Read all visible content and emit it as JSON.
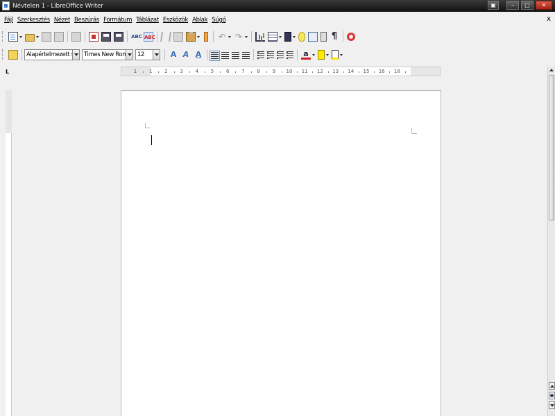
{
  "window": {
    "title": "Névtelen 1 - LibreOffice Writer"
  },
  "menu": [
    "Fájl",
    "Szerkesztés",
    "Nézet",
    "Beszúrás",
    "Formátum",
    "Táblázat",
    "Eszközök",
    "Ablak",
    "Súgó"
  ],
  "doc_close": "x",
  "format_toolbar": {
    "paragraph_style": "Alapértelmezett stílus",
    "font_name": "Times New Roman",
    "font_size": "12"
  },
  "ruler": {
    "corner": "L",
    "ticks": [
      "1",
      "1",
      "2",
      "3",
      "4",
      "5",
      "6",
      "7",
      "8",
      "9",
      "10",
      "11",
      "12",
      "13",
      "14",
      "15",
      "16",
      "18"
    ]
  },
  "icons": {
    "standard": [
      "new-document-icon",
      "open-icon",
      "save-icon",
      "edit-file-icon",
      "export-pdf-icon",
      "print-icon",
      "print-preview-icon",
      "spellcheck-icon",
      "autospellcheck-icon",
      "cut-icon",
      "copy-icon",
      "paste-icon",
      "clone-formatting-icon",
      "undo-icon",
      "redo-icon",
      "chart-icon",
      "table-icon",
      "draw-functions-icon",
      "find-replace-icon",
      "navigator-icon",
      "gallery-icon",
      "formatting-marks-icon",
      "help-icon"
    ],
    "format": [
      "styles-icon",
      "bold-icon",
      "italic-icon",
      "underline-icon",
      "align-left-icon",
      "align-center-icon",
      "align-right-icon",
      "justify-icon",
      "numbering-icon",
      "bullets-icon",
      "decrease-indent-icon",
      "increase-indent-icon",
      "font-color-icon",
      "highlight-icon",
      "background-color-icon"
    ]
  }
}
